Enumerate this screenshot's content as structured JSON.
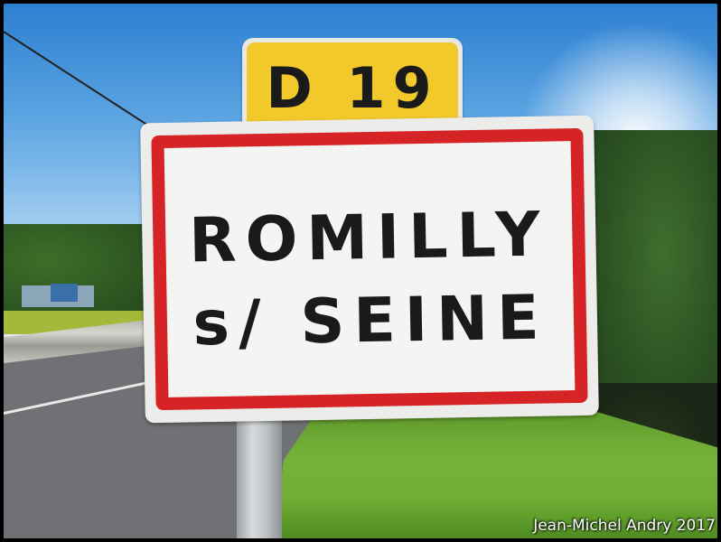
{
  "route_sign": {
    "text": "D 19"
  },
  "town_sign": {
    "line1": "ROMILLY",
    "line2": "s/ SEINE"
  },
  "credit": {
    "text": "Jean-Michel Andry 2017"
  }
}
